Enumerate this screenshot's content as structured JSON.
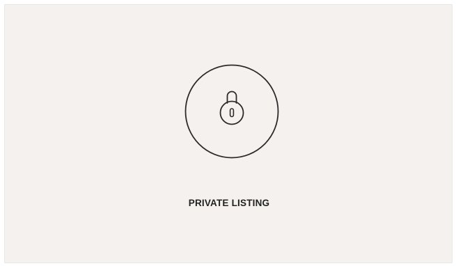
{
  "listing": {
    "label": "PRIVATE LISTING",
    "icon": "lock-icon",
    "colors": {
      "background": "#f4f1ee",
      "stroke": "#2a2a2a",
      "text": "#222222"
    }
  }
}
